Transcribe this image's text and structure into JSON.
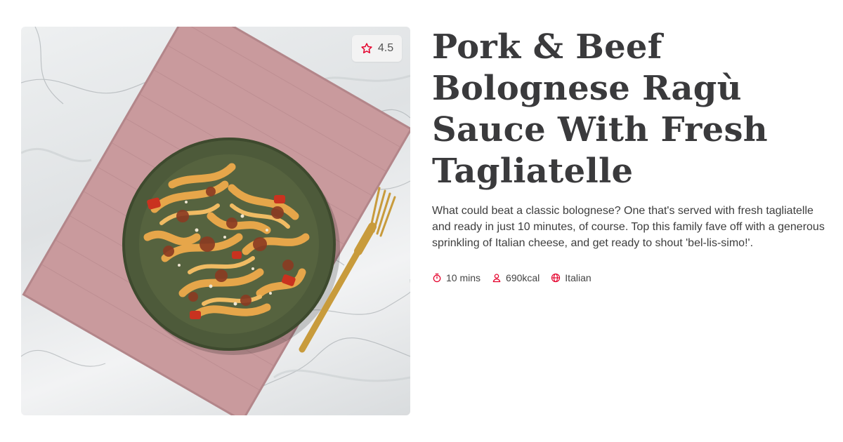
{
  "recipe": {
    "title": "Pork & Beef Bolognese Ragù Sauce With Fresh Tagliatelle",
    "description": "What could beat a classic bolognese? One that's served with fresh tagliatelle and ready in just 10 minutes, of course. Top this family fave off with a generous sprinkling of Italian cheese, and get ready to shout 'bel-lis-simo!'.",
    "rating": "4.5"
  },
  "meta": {
    "time": {
      "label": "10 mins",
      "icon": "timer-icon"
    },
    "calories": {
      "label": "690kcal",
      "icon": "person-icon"
    },
    "cuisine": {
      "label": "Italian",
      "icon": "globe-icon"
    }
  },
  "image": {
    "subject": "pasta-dish-photo"
  },
  "colors": {
    "accent": "#e4002b",
    "title": "#3a3a3c",
    "text": "#3d3d3d",
    "badge_bg": "#f3f3f3"
  }
}
